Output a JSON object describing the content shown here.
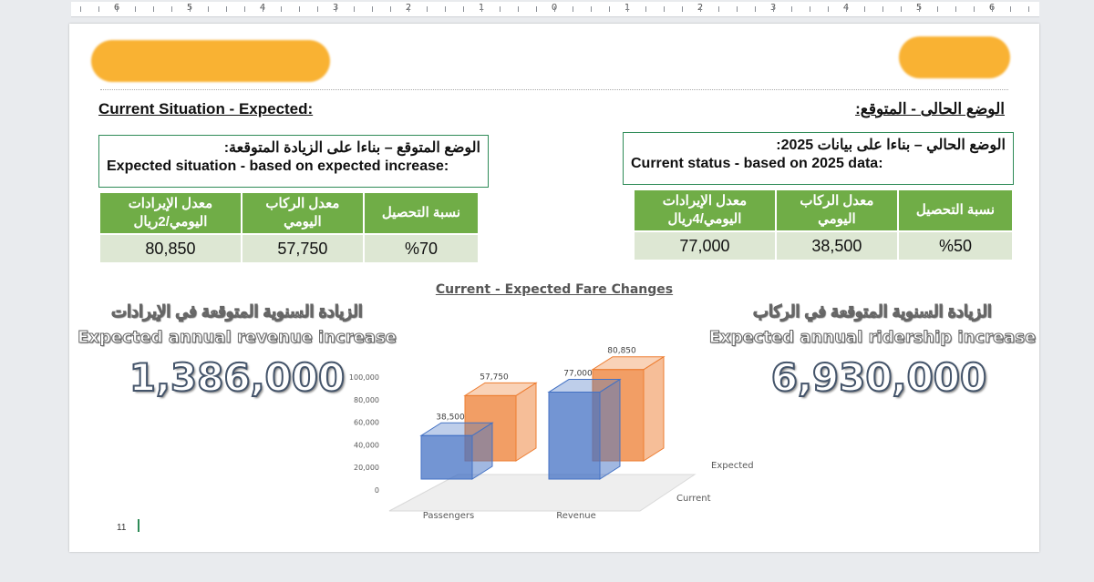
{
  "ruler": {
    "labels": [
      "6",
      "5",
      "4",
      "3",
      "2",
      "1",
      "0",
      "1",
      "2",
      "3",
      "4",
      "5",
      "6"
    ]
  },
  "headings": {
    "left_en": "Current Situation - Expected:",
    "right_ar": "الوضع الحالى - المتوقع:"
  },
  "expected_box": {
    "ar": "الوضع المتوقع – بناءا على الزيادة المتوقعة:",
    "en": "Expected situation - based on expected increase:"
  },
  "current_box": {
    "ar": "الوضع الحالي – بناءا على بيانات 2025:",
    "en": "Current status - based on 2025 data:"
  },
  "expected_table": {
    "headers": [
      "معدل الإيرادات اليومي/2ريال",
      "معدل الركاب اليومي",
      "نسبة التحصيل"
    ],
    "values": [
      "80,850",
      "57,750",
      "%70"
    ]
  },
  "current_table": {
    "headers": [
      "معدل الإيرادات اليومي/4ريال",
      "معدل الركاب اليومي",
      "نسبة التحصيل"
    ],
    "values": [
      "77,000",
      "38,500",
      "%50"
    ]
  },
  "revenue_increase": {
    "ar": "الزيادة السنوية المتوقعة في الإيرادات",
    "en": "Expected annual revenue increase",
    "value": "1,386,000"
  },
  "ridership_increase": {
    "ar": "الزيادة السنوية المتوقعة في الركاب",
    "en": "Expected annual ridership increase",
    "value": "6,930,000"
  },
  "page_number": "11",
  "chart_data": {
    "type": "bar",
    "title": "Current - Expected Fare Changes",
    "categories": [
      "Passengers",
      "Revenue"
    ],
    "series": [
      {
        "name": "Current",
        "values": [
          38500,
          77000
        ],
        "color": "#4472c4"
      },
      {
        "name": "Expected",
        "values": [
          57750,
          80850
        ],
        "color": "#ed7d31"
      }
    ],
    "ylim": [
      0,
      100000
    ],
    "yticks": [
      "0",
      "20,000",
      "40,000",
      "60,000",
      "80,000",
      "100,000"
    ],
    "data_labels": [
      "38,500",
      "77,000",
      "57,750",
      "80,850"
    ],
    "grid": false,
    "legend": "none"
  }
}
